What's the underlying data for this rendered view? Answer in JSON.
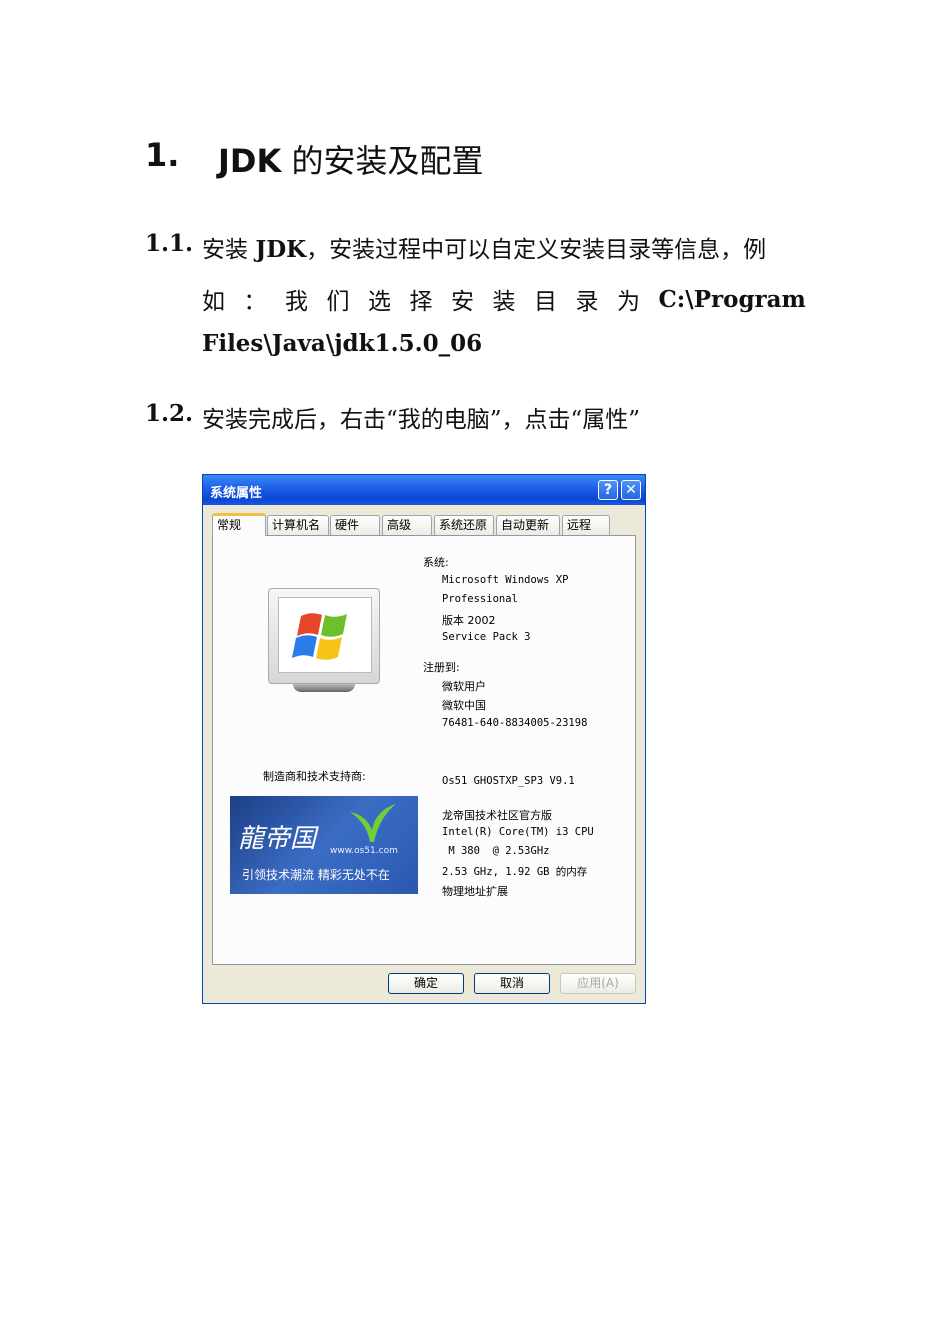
{
  "heading": {
    "number": "1.",
    "prefix": "JDK",
    "text": " 的安装及配置"
  },
  "items": [
    {
      "number": "1.1.",
      "line1_a": "安装 ",
      "line1_b": "JDK",
      "line1_c": "，安装过程中可以自定义安装目录等信息，例",
      "line2_words": [
        "如",
        "：",
        "我",
        "们",
        "选",
        "择",
        "安",
        "装",
        "目",
        "录",
        "为"
      ],
      "line2_path": "C:\\Program",
      "line3": "Files\\Java\\jdk1.5.0_06"
    },
    {
      "number": "1.2.",
      "text": "安装完成后，右击“我的电脑”，点击“属性”"
    }
  ],
  "dialog": {
    "title": "系统属性",
    "help_glyph": "?",
    "close_glyph": "✕",
    "tabs": [
      "常规",
      "计算机名",
      "硬件",
      "高级",
      "系统还原",
      "自动更新",
      "远程"
    ],
    "system_label": "系统:",
    "system_lines": [
      "Microsoft Windows XP",
      "Professional",
      "版本 2002",
      "Service Pack 3"
    ],
    "registered_label": "注册到:",
    "registered_lines": [
      "微软用户",
      "微软中国",
      "76481-640-8834005-23198"
    ],
    "manufacturer_label": "制造商和技术支持商:",
    "oem_line": "Os51 GHOSTXP_SP3 V9.1",
    "hardware_lines": [
      "龙帝国技术社区官方版",
      "Intel(R) Core(TM) i3 CPU",
      " M 380  @ 2.53GHz",
      "2.53 GHz, 1.92 GB 的内存",
      "物理地址扩展"
    ],
    "banner": {
      "logo": "龍帝国",
      "url": "www.os51.com",
      "slogan": "引领技术潮流  精彩无处不在"
    },
    "buttons": {
      "ok": "确定",
      "cancel": "取消",
      "apply": "应用(A)"
    }
  }
}
